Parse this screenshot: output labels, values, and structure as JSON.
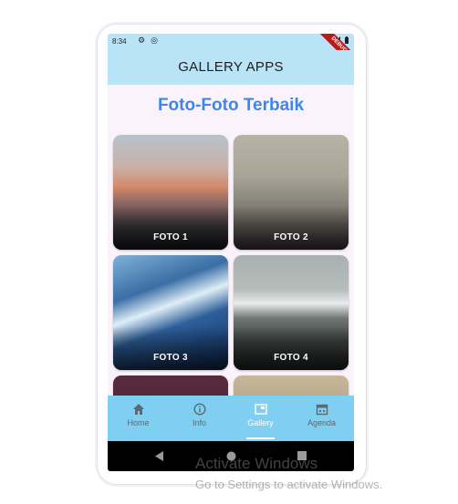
{
  "status_bar": {
    "time": "8:34",
    "debug_banner": "DEBUG"
  },
  "app_bar": {
    "title": "GALLERY APPS"
  },
  "page": {
    "heading": "Foto-Foto Terbaik"
  },
  "photos": [
    {
      "label": "FOTO 1"
    },
    {
      "label": "FOTO 2"
    },
    {
      "label": "FOTO 3"
    },
    {
      "label": "FOTO 4"
    }
  ],
  "bottom_nav": {
    "items": [
      {
        "label": "Home",
        "icon": "home-icon"
      },
      {
        "label": "Info",
        "icon": "info-icon"
      },
      {
        "label": "Gallery",
        "icon": "gallery-icon",
        "active": true
      },
      {
        "label": "Agenda",
        "icon": "calendar-icon"
      }
    ]
  },
  "watermark": {
    "line1": "Activate Windows",
    "line2": "Go to Settings to activate Windows."
  },
  "colors": {
    "app_bar": "#b9e4f7",
    "heading": "#3e86ee",
    "bottom_nav": "#7fcff2"
  }
}
